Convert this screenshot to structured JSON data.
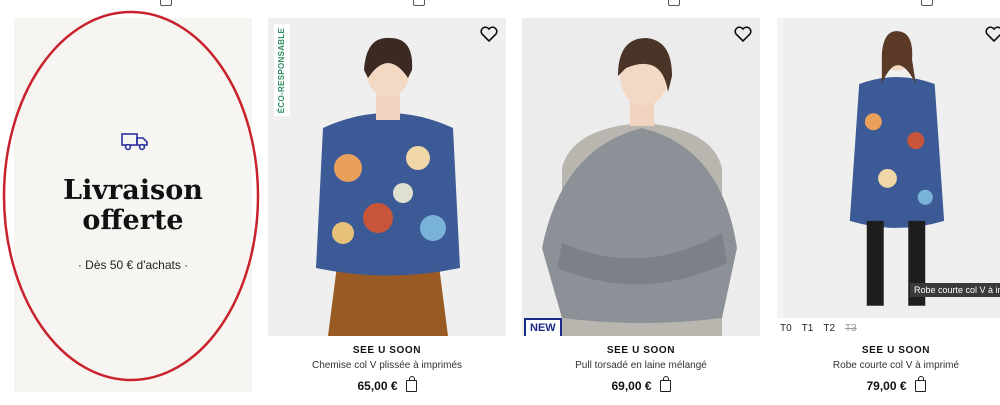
{
  "promo": {
    "title": "Livraison offerte",
    "subtitle": "· Dès 50 € d'achats ·",
    "icon": "truck-icon",
    "accent": "#2b2fa0",
    "annotation_color": "#c8232c"
  },
  "products": [
    {
      "badge": "ÉCO-RESPONSABLE",
      "brand": "SEE U SOON",
      "name": "Chemise col V plissée à imprimés",
      "price": "65,00 €"
    },
    {
      "badge": "NEW",
      "brand": "SEE U SOON",
      "name": "Pull torsadé en laine mélangé",
      "price": "69,00 €"
    },
    {
      "brand": "SEE U SOON",
      "name": "Robe courte col V à imprimé",
      "price": "79,00 €",
      "sizes": [
        "T0",
        "T1",
        "T2",
        "T3"
      ],
      "unavailable_size": "T3",
      "tooltip": "Robe courte col V à imprimé"
    }
  ],
  "icons": {
    "wishlist": "heart-icon",
    "cart": "bag-icon",
    "carousel_prev": "chevron-left-icon"
  }
}
